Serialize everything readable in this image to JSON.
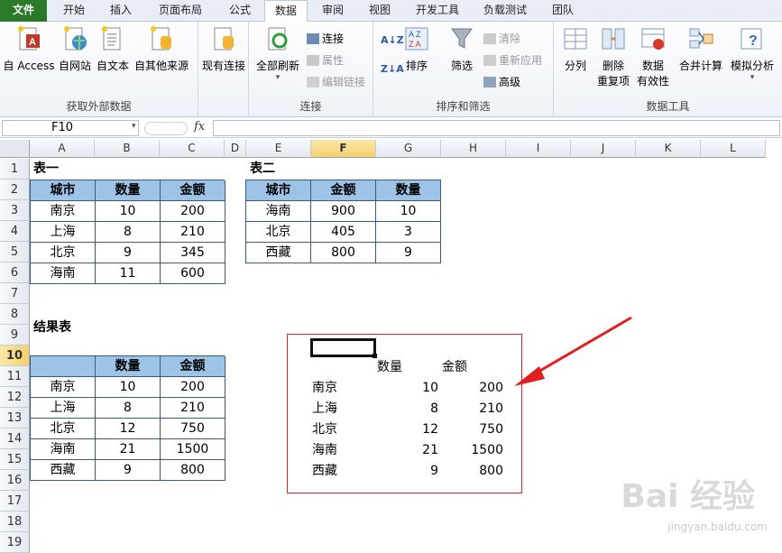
{
  "tabs": [
    "文件",
    "开始",
    "插入",
    "页面布局",
    "公式",
    "数据",
    "审阅",
    "视图",
    "开发工具",
    "负载测试",
    "团队"
  ],
  "active_tab": "数据",
  "groups": {
    "external": {
      "label": "获取外部数据",
      "buttons": [
        "自 Access",
        "自网站",
        "自文本",
        "自其他来源",
        "现有连接"
      ]
    },
    "connections": {
      "label": "连接",
      "refresh": "全部刷新",
      "items": [
        "连接",
        "属性",
        "编辑链接"
      ]
    },
    "sort_filter": {
      "label": "排序和筛选",
      "sort": "排序",
      "filter": "筛选",
      "items": [
        "清除",
        "重新应用",
        "高级"
      ]
    },
    "tools": {
      "label": "数据工具",
      "split": "分列",
      "dedupe": [
        "删除",
        "重复项"
      ],
      "validation": [
        "数据",
        "有效性"
      ],
      "consolidate": "合并计算",
      "whatif": "模拟分析"
    }
  },
  "formula_bar": {
    "name_box": "F10",
    "fx": "fx",
    "formula": ""
  },
  "columns": [
    "A",
    "B",
    "C",
    "D",
    "E",
    "F",
    "G",
    "H",
    "I",
    "J",
    "K",
    "L"
  ],
  "selected_column": "F",
  "rows": [
    "1",
    "2",
    "3",
    "4",
    "5",
    "6",
    "7",
    "8",
    "9",
    "10",
    "11",
    "12",
    "13",
    "14",
    "15",
    "16",
    "17",
    "18",
    "19"
  ],
  "selected_row": "10",
  "table1": {
    "title": "表一",
    "headers": [
      "城市",
      "数量",
      "金额"
    ],
    "rows": [
      [
        "南京",
        "10",
        "200"
      ],
      [
        "上海",
        "8",
        "210"
      ],
      [
        "北京",
        "9",
        "345"
      ],
      [
        "海南",
        "11",
        "600"
      ]
    ]
  },
  "table2": {
    "title": "表二",
    "headers": [
      "城市",
      "金额",
      "数量"
    ],
    "rows": [
      [
        "海南",
        "900",
        "10"
      ],
      [
        "北京",
        "405",
        "3"
      ],
      [
        "西藏",
        "800",
        "9"
      ]
    ]
  },
  "result": {
    "title": "结果表",
    "headers": [
      "",
      "数量",
      "金额"
    ],
    "rows": [
      [
        "南京",
        "10",
        "200"
      ],
      [
        "上海",
        "8",
        "210"
      ],
      [
        "北京",
        "12",
        "750"
      ],
      [
        "海南",
        "21",
        "1500"
      ],
      [
        "西藏",
        "9",
        "800"
      ]
    ]
  },
  "consolidated": {
    "headers": [
      "数量",
      "金额"
    ],
    "rows": [
      [
        "南京",
        "10",
        "200"
      ],
      [
        "上海",
        "8",
        "210"
      ],
      [
        "北京",
        "12",
        "750"
      ],
      [
        "海南",
        "21",
        "1500"
      ],
      [
        "西藏",
        "9",
        "800"
      ]
    ]
  },
  "watermark": {
    "logo": "Bai 经验",
    "url": "jingyan.baidu.com"
  },
  "colors": {
    "accent_file": "#2a7a2a",
    "header_fill": "#9dc3e6",
    "highlight_box": "#e02020",
    "arrow": "#e02020"
  }
}
